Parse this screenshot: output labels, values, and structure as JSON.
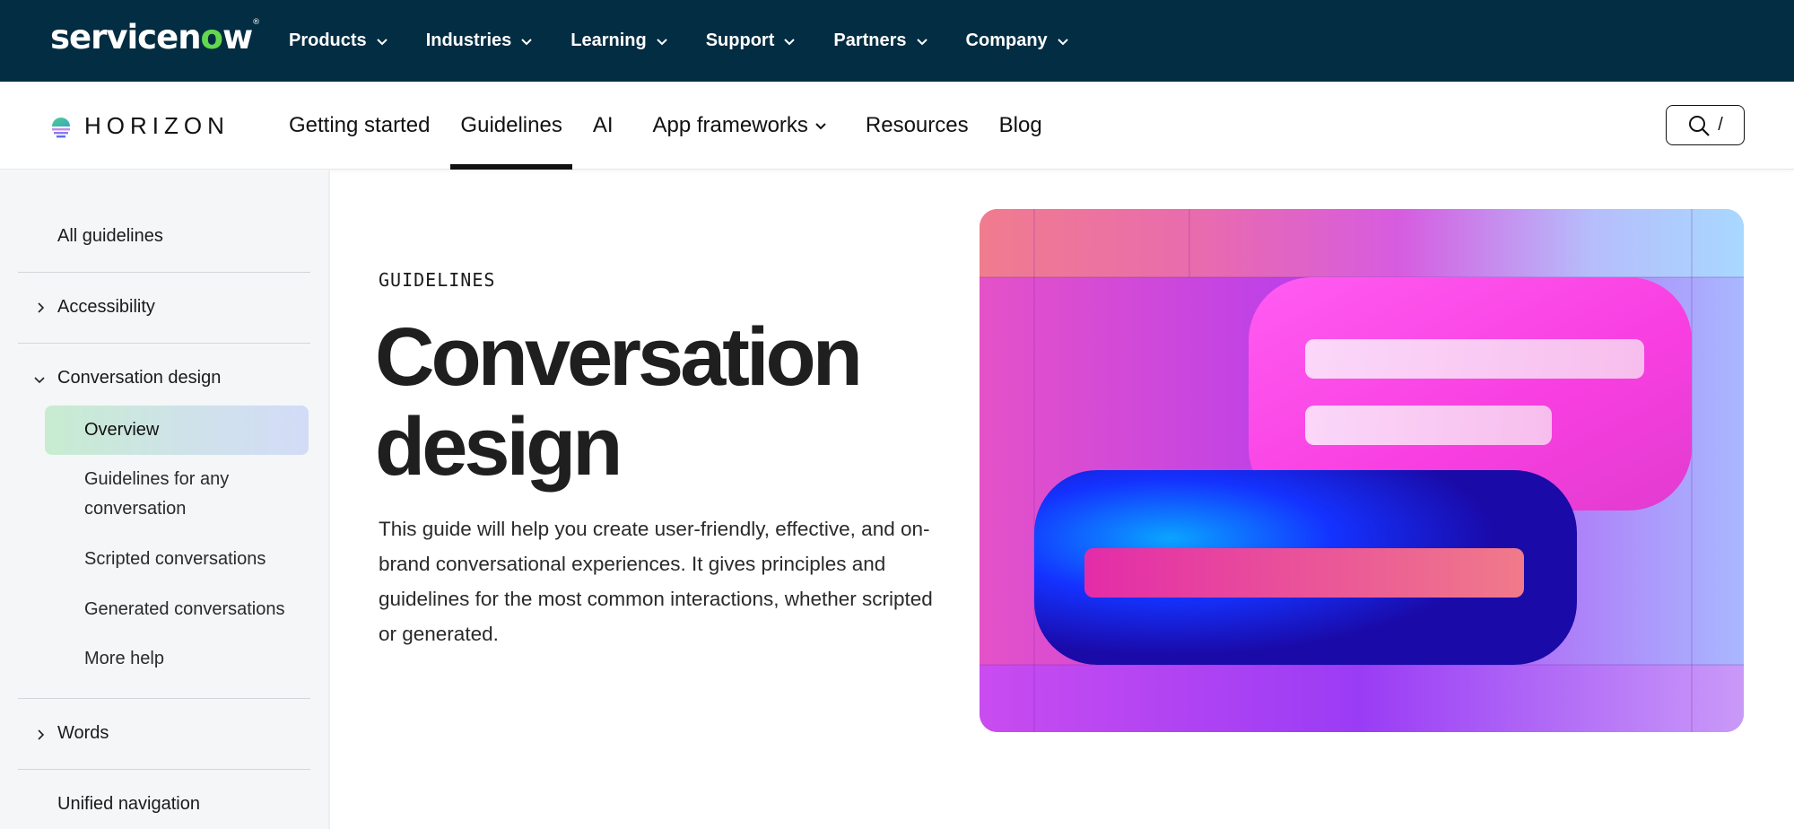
{
  "topbar": {
    "brand": {
      "pre": "servicen",
      "o": "o",
      "post": "w"
    },
    "items": [
      {
        "label": "Products"
      },
      {
        "label": "Industries"
      },
      {
        "label": "Learning"
      },
      {
        "label": "Support"
      },
      {
        "label": "Partners"
      },
      {
        "label": "Company"
      }
    ]
  },
  "subbar": {
    "brand": "HORIZON",
    "items": [
      {
        "label": "Getting started",
        "active": false
      },
      {
        "label": "Guidelines",
        "active": true
      },
      {
        "label": "AI",
        "active": false
      },
      {
        "label": "App frameworks",
        "active": false,
        "dropdown": true
      },
      {
        "label": "Resources",
        "active": false
      },
      {
        "label": "Blog",
        "active": false
      }
    ],
    "search_shortcut": "/"
  },
  "sidebar": {
    "all_guidelines": "All guidelines",
    "accessibility": "Accessibility",
    "conversation_design": "Conversation design",
    "children": [
      {
        "label": "Overview"
      },
      {
        "label": "Guidelines for any",
        "label2": "conversation"
      },
      {
        "label": "Scripted conversations"
      },
      {
        "label": "Generated conversations"
      },
      {
        "label": "More help"
      }
    ],
    "words": "Words",
    "unified_navigation": "Unified navigation"
  },
  "main": {
    "eyebrow": "GUIDELINES",
    "title_line1": "Conversation",
    "title_line2": "design",
    "description": "This guide will help you create user-friendly, effective, and on-brand conversational experiences. It gives principles and guidelines for the most common interactions, whether scripted or generated."
  },
  "colors": {
    "topbar_bg": "#032d42",
    "brand_green": "#62d84e",
    "active_gradient": [
      "#c7ecd0",
      "#d2dcf7"
    ]
  },
  "icons": {
    "chevron": "chevron-down-icon",
    "caret_right": "chevron-right-icon",
    "search": "search-icon"
  }
}
